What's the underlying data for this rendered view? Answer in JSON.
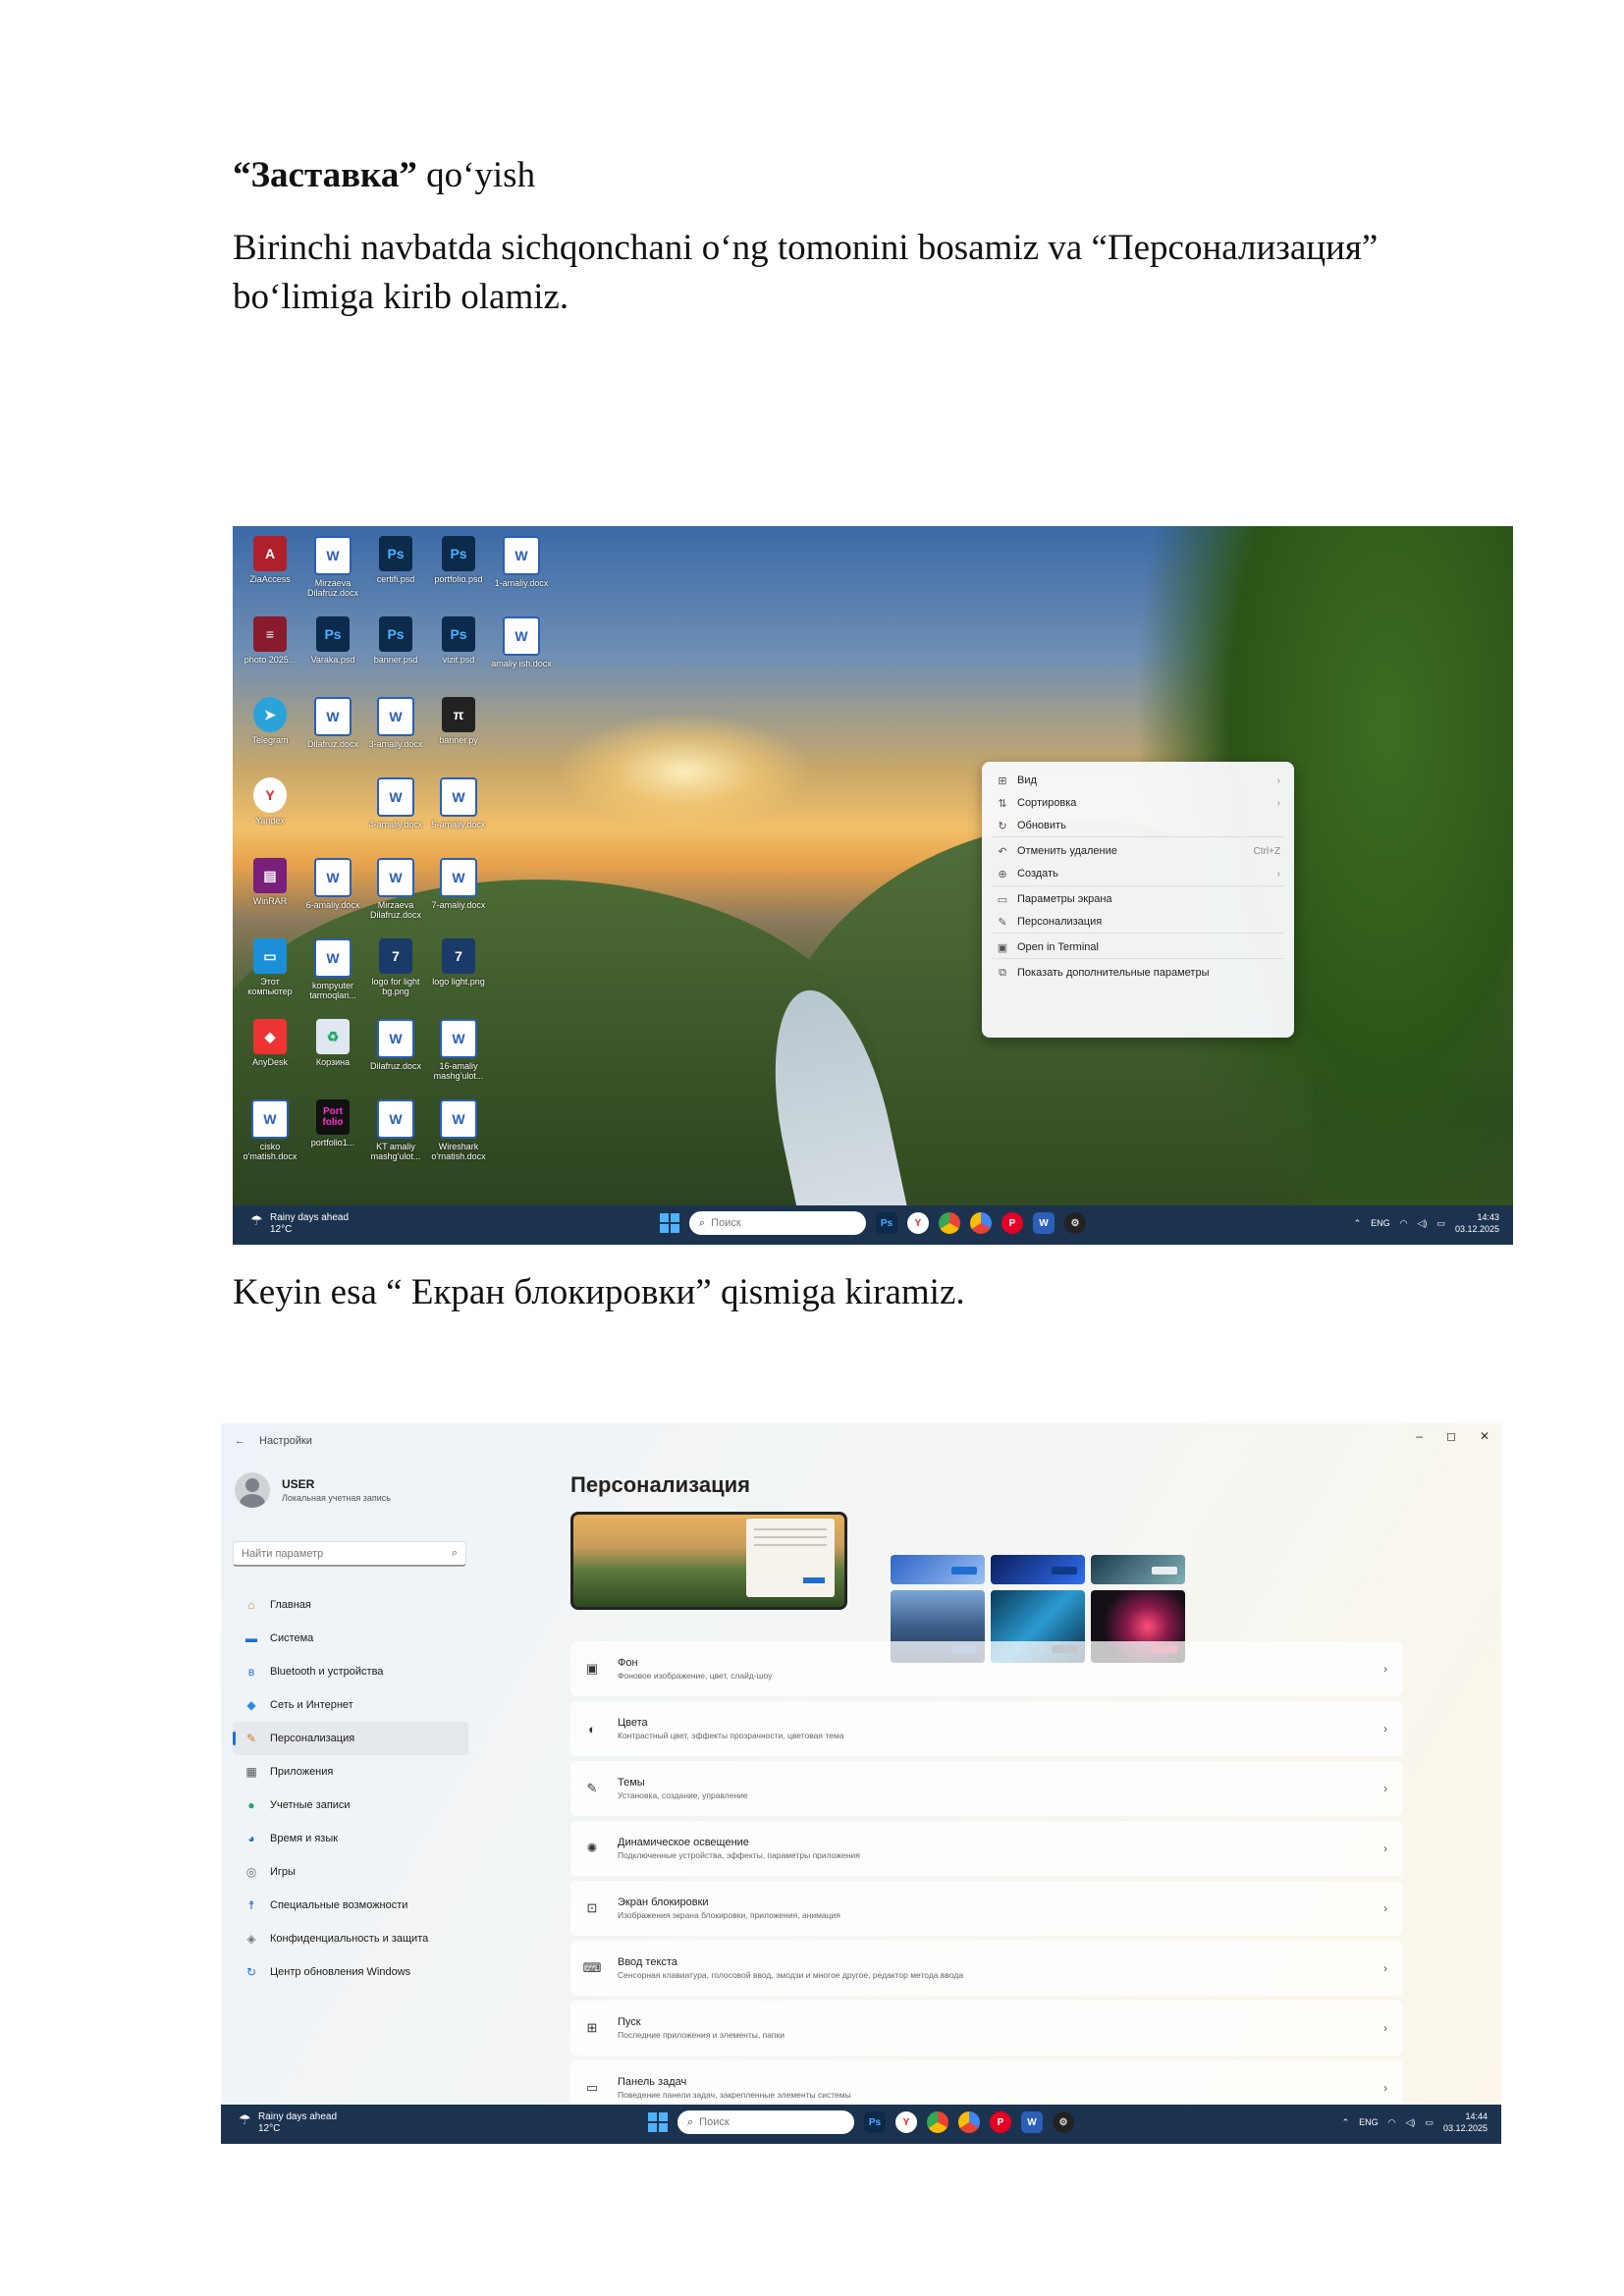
{
  "doc": {
    "heading_bold": "“Заставка”",
    "heading_rest": " qo‘yish",
    "para1": "Birinchi navbatda sichqonchani o‘ng tomonini bosamiz va “Персонализация” bo‘limiga kirib olamiz.",
    "para2": "Keyin esa “ Екран блокировки” qismiga kiramiz."
  },
  "desktop": {
    "icons": [
      {
        "label": "ZiaAccess",
        "icon": "access-icon",
        "glyph": "A",
        "style": "g-acc"
      },
      {
        "label": "Mirzaeva Dilafruz.docx",
        "icon": "word-icon",
        "glyph": "W",
        "style": "g-word"
      },
      {
        "label": "certifi.psd",
        "icon": "photoshop-icon",
        "glyph": "Ps",
        "style": "g-ps"
      },
      {
        "label": "portfolio.psd",
        "icon": "photoshop-icon",
        "glyph": "Ps",
        "style": "g-ps"
      },
      {
        "label": "1-amaliy.docx",
        "icon": "word-icon",
        "glyph": "W",
        "style": "g-word"
      },
      {
        "label": "photo 2025...",
        "icon": "pdf-icon",
        "glyph": "≡",
        "style": "g-pdf"
      },
      {
        "label": "Varaka.psd",
        "icon": "photoshop-icon",
        "glyph": "Ps",
        "style": "g-ps"
      },
      {
        "label": "banner.psd",
        "icon": "photoshop-icon",
        "glyph": "Ps",
        "style": "g-ps"
      },
      {
        "label": "vizit.psd",
        "icon": "photoshop-icon",
        "glyph": "Ps",
        "style": "g-ps"
      },
      {
        "label": "amaliy ish.docx",
        "icon": "word-icon",
        "glyph": "W",
        "style": "g-word"
      },
      {
        "label": "Telegram",
        "icon": "telegram-icon",
        "glyph": "➤",
        "style": "g-tel"
      },
      {
        "label": "Dilafruz.docx",
        "icon": "word-icon",
        "glyph": "W",
        "style": "g-word"
      },
      {
        "label": "3-amaliy.docx",
        "icon": "word-icon",
        "glyph": "W",
        "style": "g-word"
      },
      {
        "label": "banner.py",
        "icon": "pi-icon",
        "glyph": "π",
        "style": "g-pi"
      },
      {
        "label": "",
        "icon": "",
        "glyph": "",
        "style": ""
      },
      {
        "label": "Yandex",
        "icon": "yandex-icon",
        "glyph": "Y",
        "style": "g-ya"
      },
      {
        "label": "",
        "icon": "",
        "glyph": "",
        "style": ""
      },
      {
        "label": "4-amaliy.docx",
        "icon": "word-icon",
        "glyph": "W",
        "style": "g-word"
      },
      {
        "label": "5-amaliy.docx",
        "icon": "word-icon",
        "glyph": "W",
        "style": "g-word"
      },
      {
        "label": "",
        "icon": "",
        "glyph": "",
        "style": ""
      },
      {
        "label": "WinRAR",
        "icon": "winrar-icon",
        "glyph": "▤",
        "style": "g-rar"
      },
      {
        "label": "6-amaliy.docx",
        "icon": "word-icon",
        "glyph": "W",
        "style": "g-word"
      },
      {
        "label": "Mirzaeva Dilafruz.docx",
        "icon": "word-icon",
        "glyph": "W",
        "style": "g-word"
      },
      {
        "label": "7-amaliy.docx",
        "icon": "word-icon",
        "glyph": "W",
        "style": "g-word"
      },
      {
        "label": "",
        "icon": "",
        "glyph": "",
        "style": ""
      },
      {
        "label": "Этот компьютер",
        "icon": "computer-icon",
        "glyph": "▭",
        "style": "g-pc"
      },
      {
        "label": "kompyuter tarmoqlari...",
        "icon": "word-icon",
        "glyph": "W",
        "style": "g-word"
      },
      {
        "label": "logo for light bg.png",
        "icon": "logo-icon",
        "glyph": "7",
        "style": "g-logo"
      },
      {
        "label": "logo light.png",
        "icon": "logo-icon",
        "glyph": "7",
        "style": "g-logo"
      },
      {
        "label": "",
        "icon": "",
        "glyph": "",
        "style": ""
      },
      {
        "label": "AnyDesk",
        "icon": "anydesk-icon",
        "glyph": "◆",
        "style": "g-any"
      },
      {
        "label": "Корзина",
        "icon": "recycle-bin-icon",
        "glyph": "♻",
        "style": "g-bin"
      },
      {
        "label": "Dilafruz.docx",
        "icon": "word-icon",
        "glyph": "W",
        "style": "g-word"
      },
      {
        "label": "16-amaliy mashg'ulot...",
        "icon": "word-icon",
        "glyph": "W",
        "style": "g-word"
      },
      {
        "label": "",
        "icon": "",
        "glyph": "",
        "style": ""
      },
      {
        "label": "cisko o'matish.docx",
        "icon": "word-icon",
        "glyph": "W",
        "style": "g-word"
      },
      {
        "label": "portfolio1...",
        "icon": "portfolio-icon",
        "glyph": "Port folio",
        "style": "g-port"
      },
      {
        "label": "KT amaliy mashg'ulot...",
        "icon": "word-icon",
        "glyph": "W",
        "style": "g-word"
      },
      {
        "label": "Wireshark o'rnatish.docx",
        "icon": "word-icon",
        "glyph": "W",
        "style": "g-word"
      }
    ],
    "context_menu": [
      {
        "icon": "⊞",
        "name": "view-icon",
        "label": "Вид",
        "arrow": "›",
        "shortcut": ""
      },
      {
        "icon": "⇅",
        "name": "sort-icon",
        "label": "Сортировка",
        "arrow": "›",
        "shortcut": ""
      },
      {
        "icon": "↻",
        "name": "refresh-icon",
        "label": "Обновить",
        "arrow": "",
        "shortcut": ""
      },
      {
        "icon": "↶",
        "name": "undo-icon",
        "label": "Отменить удаление",
        "arrow": "",
        "shortcut": "Ctrl+Z"
      },
      {
        "icon": "⊕",
        "name": "new-icon",
        "label": "Создать",
        "arrow": "›",
        "shortcut": ""
      },
      {
        "icon": "▭",
        "name": "display-icon",
        "label": "Параметры экрана",
        "arrow": "",
        "shortcut": ""
      },
      {
        "icon": "✎",
        "name": "brush-icon",
        "label": "Персонализация",
        "arrow": "",
        "shortcut": ""
      },
      {
        "icon": "▣",
        "name": "terminal-icon",
        "label": "Open in Terminal",
        "arrow": "",
        "shortcut": ""
      },
      {
        "icon": "⧉",
        "name": "more-options-icon",
        "label": "Показать дополнительные параметры",
        "arrow": "",
        "shortcut": ""
      }
    ],
    "taskbar": {
      "weather_title": "Rainy days ahead",
      "weather_temp": "12°C",
      "search_placeholder": "Поиск",
      "lang": "ENG",
      "time": "14:43",
      "date": "03.12.2025"
    }
  },
  "settings": {
    "back_label": "Настройки",
    "user_name": "USER",
    "user_sub": "Локальная учетная запись",
    "search_placeholder": "Найти параметр",
    "page_title": "Персонализация",
    "nav": [
      {
        "icon": "⌂",
        "name": "home-icon",
        "label": "Главная",
        "color": "#e08a1e"
      },
      {
        "icon": "▬",
        "name": "system-icon",
        "label": "Система",
        "color": "#1f6fd1"
      },
      {
        "icon": "ʙ",
        "name": "bluetooth-icon",
        "label": "Bluetooth и устройства",
        "color": "#1f6fd1"
      },
      {
        "icon": "◆",
        "name": "network-icon",
        "label": "Сеть и Интернет",
        "color": "#2b8ae0"
      },
      {
        "icon": "✎",
        "name": "brush-icon",
        "label": "Персонализация",
        "color": "#d47a1a"
      },
      {
        "icon": "▦",
        "name": "apps-icon",
        "label": "Приложения",
        "color": "#555"
      },
      {
        "icon": "●",
        "name": "accounts-icon",
        "label": "Учетные записи",
        "color": "#2aa36b"
      },
      {
        "icon": "◕",
        "name": "time-language-icon",
        "label": "Время и язык",
        "color": "#1f6fd1"
      },
      {
        "icon": "◎",
        "name": "gaming-icon",
        "label": "Игры",
        "color": "#666"
      },
      {
        "icon": "☨",
        "name": "accessibility-icon",
        "label": "Специальные возможности",
        "color": "#1f6fd1"
      },
      {
        "icon": "◈",
        "name": "privacy-icon",
        "label": "Конфиденциальность и защита",
        "color": "#777"
      },
      {
        "icon": "↻",
        "name": "update-icon",
        "label": "Центр обновления Windows",
        "color": "#1f6fd1"
      }
    ],
    "active_nav": 4,
    "cards": [
      {
        "icon": "▣",
        "name": "background-icon",
        "title": "Фон",
        "desc": "Фоновое изображение, цвет, слайд-шоу"
      },
      {
        "icon": "◐",
        "name": "colors-icon",
        "title": "Цвета",
        "desc": "Контрастный цвет, эффекты прозрачности, цветовая тема"
      },
      {
        "icon": "✎",
        "name": "themes-icon",
        "title": "Темы",
        "desc": "Установка, создание, управление"
      },
      {
        "icon": "✺",
        "name": "dynamic-lighting-icon",
        "title": "Динамическое освещение",
        "desc": "Подключенные устройства, эффекты, параметры приложения"
      },
      {
        "icon": "⊡",
        "name": "lock-screen-icon",
        "title": "Экран блокировки",
        "desc": "Изображения экрана блокировки, приложения, анимация"
      },
      {
        "icon": "⌨",
        "name": "keyboard-icon",
        "title": "Ввод текста",
        "desc": "Сенсорная клавиатура, голосовой ввод, эмодзи и многое другое, редактор метода ввода"
      },
      {
        "icon": "⊞",
        "name": "start-icon",
        "title": "Пуск",
        "desc": "Последние приложения и элементы, папки"
      },
      {
        "icon": "▭",
        "name": "taskbar-icon",
        "title": "Панель задач",
        "desc": "Поведение панели задач, закрепленные элементы системы"
      }
    ],
    "taskbar": {
      "weather_title": "Rainy days ahead",
      "weather_temp": "12°C",
      "search_placeholder": "Поиск",
      "lang": "ENG",
      "time": "14:44",
      "date": "03.12.2025"
    }
  }
}
